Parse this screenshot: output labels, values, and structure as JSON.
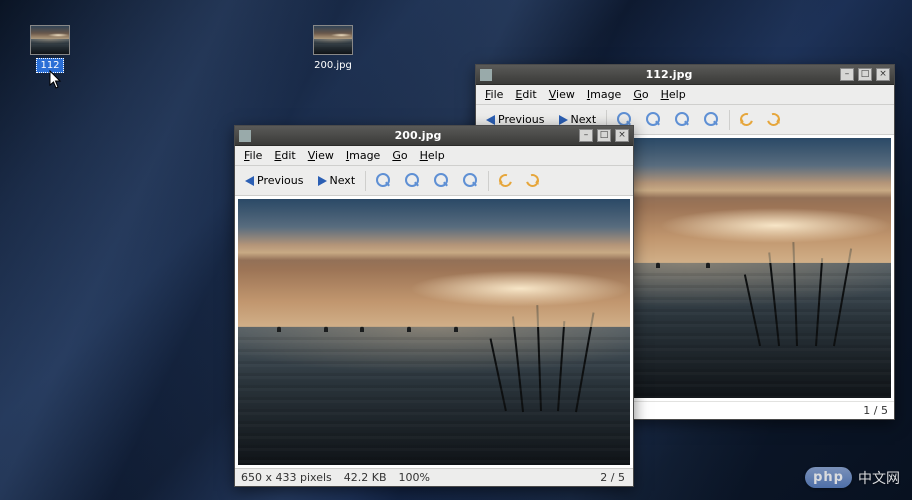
{
  "desktop": {
    "icons": [
      {
        "label": "112",
        "selected": true
      },
      {
        "label": "200.jpg",
        "selected": false
      }
    ]
  },
  "menu": {
    "file": "File",
    "edit": "Edit",
    "view": "View",
    "image": "Image",
    "go": "Go",
    "help": "Help"
  },
  "toolbar": {
    "previous": "Previous",
    "next": "Next"
  },
  "window_back": {
    "title": "112.jpg",
    "counter": "1 / 5"
  },
  "window_front": {
    "title": "200.jpg",
    "counter": "2 / 5",
    "status": {
      "dimensions": "650 x 433 pixels",
      "filesize": "42.2 KB",
      "zoom": "100%"
    }
  },
  "watermark": {
    "pill": "php",
    "text": "中文网"
  }
}
